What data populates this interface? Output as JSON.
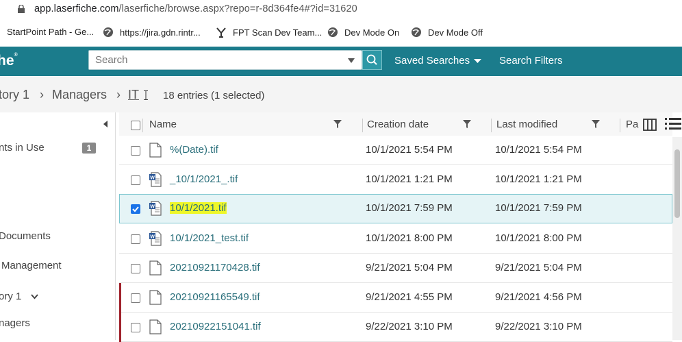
{
  "browser": {
    "url_host": "app.laserfiche.com",
    "url_path": "/laserfiche/browse.aspx?repo=r-8d364fe4#?id=31620",
    "bookmarks": [
      {
        "label": "StartPoint Path - Ge..."
      },
      {
        "label": "https://jira.gdn.rintr..."
      },
      {
        "label": "FPT Scan Dev Team..."
      },
      {
        "label": "Dev Mode On"
      },
      {
        "label": "Dev Mode Off"
      }
    ]
  },
  "app": {
    "logo_text": "he",
    "search_placeholder": "Search",
    "saved_searches": "Saved Searches",
    "search_filters": "Search Filters"
  },
  "breadcrumb": {
    "item1": "tory 1",
    "sep": "›",
    "item2": "Managers",
    "item3": "IT",
    "entries": "18 entries (1 selected)"
  },
  "sidebar": {
    "items": [
      {
        "label": "nts in Use"
      },
      {
        "label": "Documents"
      },
      {
        "label": "Management"
      },
      {
        "label": "ory 1"
      },
      {
        "label": "nagers"
      }
    ],
    "badge": "1"
  },
  "table": {
    "columns": {
      "name": "Name",
      "creation": "Creation date",
      "modified": "Last modified",
      "pa": "Pa"
    },
    "rows": [
      {
        "name": "%(Date).tif",
        "created": "10/1/2021 5:54 PM",
        "modified": "10/1/2021 5:54 PM",
        "icon": "page-icon"
      },
      {
        "name": "_10/1/2021_.tif",
        "created": "10/1/2021 1:21 PM",
        "modified": "10/1/2021 1:21 PM",
        "icon": "word-doc-icon"
      },
      {
        "name": "10/1/2021.tif",
        "created": "10/1/2021 7:59 PM",
        "modified": "10/1/2021 7:59 PM",
        "icon": "word-doc-icon"
      },
      {
        "name": "10/1/2021_test.tif",
        "created": "10/1/2021 8:00 PM",
        "modified": "10/1/2021 8:00 PM",
        "icon": "word-doc-icon"
      },
      {
        "name": "20210921170428.tif",
        "created": "9/21/2021 5:04 PM",
        "modified": "9/21/2021 5:04 PM",
        "icon": "page-icon"
      },
      {
        "name": "20210921165549.tif",
        "created": "9/21/2021 4:55 PM",
        "modified": "9/21/2021 4:56 PM",
        "icon": "page-icon"
      },
      {
        "name": "20210922151041.tif",
        "created": "9/22/2021 3:10 PM",
        "modified": "9/22/2021 3:10 PM",
        "icon": "page-icon"
      }
    ]
  },
  "colors": {
    "teal_bar": "#1b7c8c",
    "link": "#2a6f7b",
    "highlight": "#eef72a",
    "marker": "#a0222c"
  }
}
